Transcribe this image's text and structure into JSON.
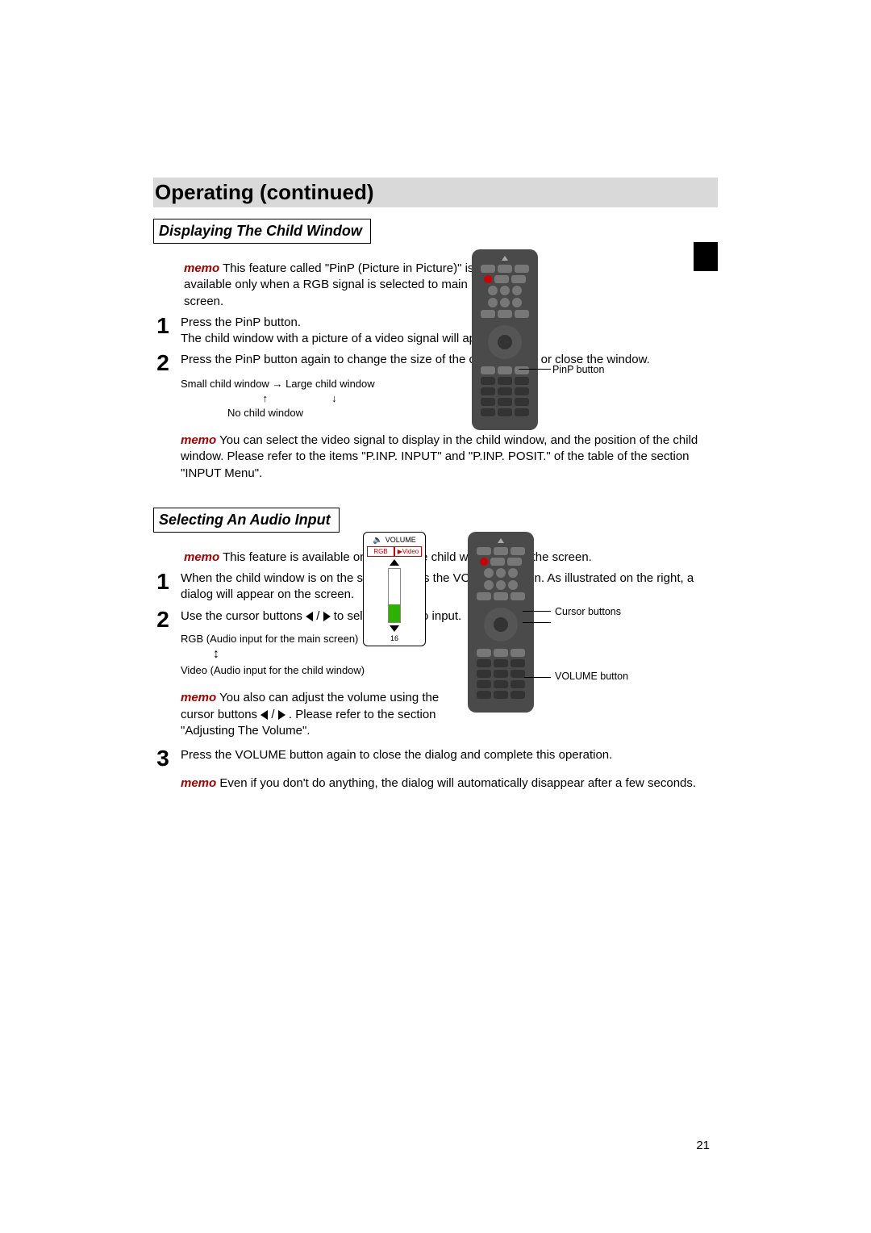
{
  "banner_title": "Operating (continued)",
  "section1": {
    "heading": "Displaying The Child Window",
    "memo_label": "memo",
    "intro_memo": " This feature called \"PinP (Picture in Picture)\" is available only when a RGB signal is selected to main screen.",
    "step1_a": "Press the PinP button.",
    "step1_b": "The child window with a picture of a video signal will appear.",
    "step2": "Press the PinP button again to change the size of the child window or close the window.",
    "cycle_small": "Small child window",
    "cycle_large": "Large child window",
    "cycle_none": "No child window",
    "memo2": " You can select the video signal to display in the child window, and the position of the child window. Please refer to the items \"P.INP. INPUT\" and \"P.INP. POSIT.\" of the table of the section \"INPUT Menu\".",
    "callout_pinp": "PinP button"
  },
  "section2": {
    "heading": "Selecting An Audio Input",
    "memo_label": "memo",
    "intro_memo": " This feature is available only when the child window is on the screen.",
    "step1": "When the child window is on the screen, press the VOLUME button. As illustrated on the right, a dialog will appear on the screen.",
    "step2_pre": "Use the cursor buttons ",
    "step2_post": " to select an audio input.",
    "swap_rgb": "RGB (Audio input for the main screen)",
    "swap_video": "Video (Audio input for the child window)",
    "memo2_pre": " You also can adjust the volume using the cursor buttons ",
    "memo2_post": " . Please refer to the section \"Adjusting The Volume\".",
    "step3": "Press the VOLUME button again to close the dialog and complete this operation.",
    "memo3": " Even if you don't do anything, the dialog will automatically disappear after a few seconds.",
    "callout_cursor": "Cursor buttons",
    "callout_volume": "VOLUME button",
    "dialog": {
      "title": "VOLUME",
      "tab_rgb": "RGB",
      "tab_video": "Video",
      "value": "16",
      "fill_pct": 33
    }
  },
  "page_number": "21",
  "steps": {
    "n1": "1",
    "n2": "2",
    "n3": "3"
  }
}
